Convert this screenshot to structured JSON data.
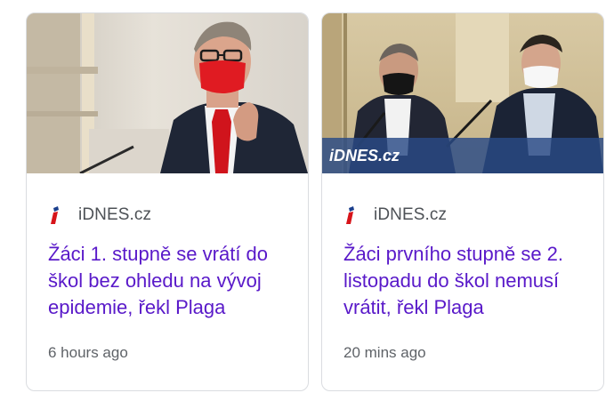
{
  "cards": [
    {
      "source": "iDNES.cz",
      "headline": "Žáci 1. stupně se vrátí do škol bez ohledu na vývoj epidemie, řekl Plaga",
      "time": "6 hours ago",
      "image_watermark": ""
    },
    {
      "source": "iDNES.cz",
      "headline": "Žáci prvního stupně se 2. listopadu do škol nemusí vrátit, řekl Plaga",
      "time": "20 mins ago",
      "image_watermark": "iDNES.cz"
    }
  ],
  "colors": {
    "headline": "#5919c9",
    "source": "#4d5156",
    "time": "#5f6368",
    "border": "#dadce0",
    "favicon_red": "#d7141a",
    "favicon_blue": "#1a3e8c"
  }
}
